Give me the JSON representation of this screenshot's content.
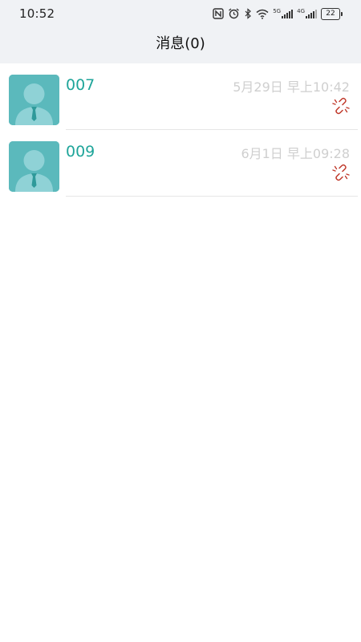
{
  "status_bar": {
    "time": "10:52",
    "battery": "22",
    "net1": "5G",
    "net2": "4G"
  },
  "header": {
    "title": "消息(0)"
  },
  "messages": [
    {
      "name": "007",
      "time": "5月29日 早上10:42",
      "icon": "broken-link-icon"
    },
    {
      "name": "009",
      "time": "6月1日 早上09:28",
      "icon": "broken-link-icon"
    }
  ],
  "colors": {
    "accent": "#1fa59a",
    "avatar_bg": "#5bb9bc",
    "timestamp": "#cfcfcf",
    "disconnected": "#c0392b"
  }
}
